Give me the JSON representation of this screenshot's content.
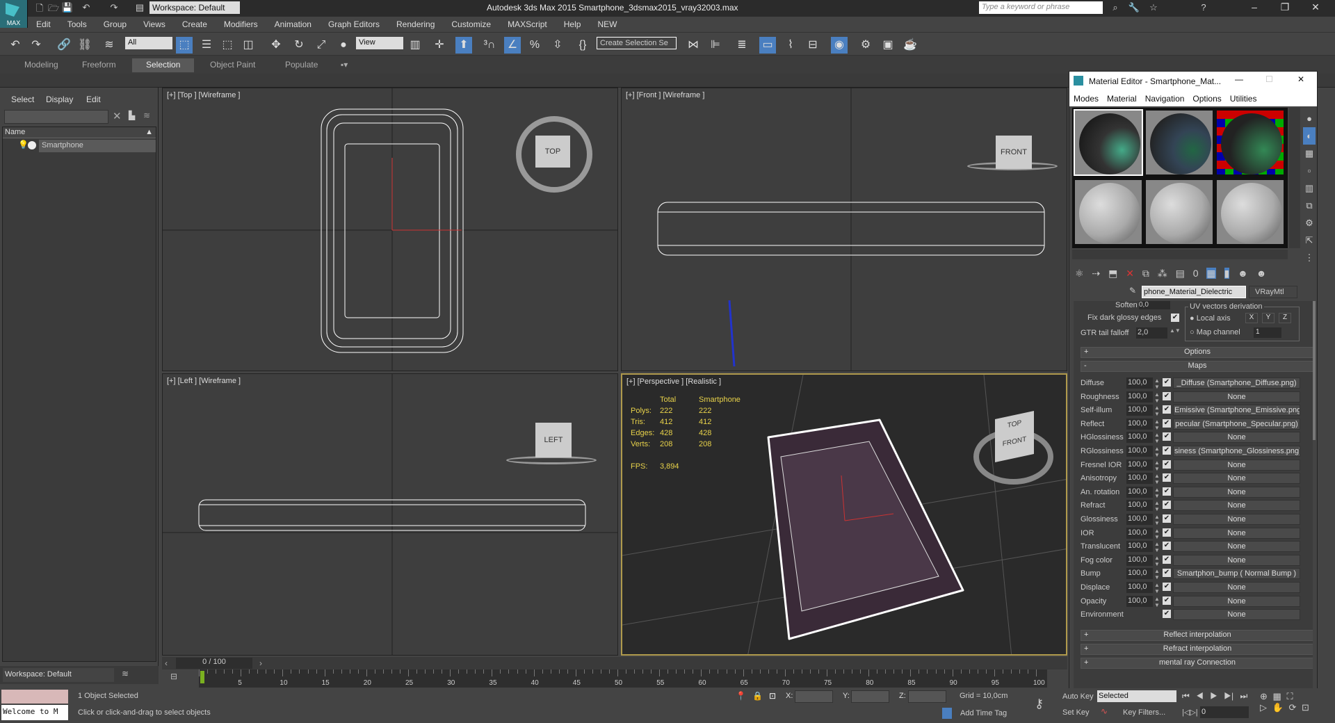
{
  "titlebar": {
    "workspace": "Workspace: Default",
    "app_title": "Autodesk 3ds Max  2015    Smartphone_3dsmax2015_vray32003.max",
    "search_placeholder": "Type a keyword or phrase",
    "logo_text": "MAX"
  },
  "menu": [
    "Edit",
    "Tools",
    "Group",
    "Views",
    "Create",
    "Modifiers",
    "Animation",
    "Graph Editors",
    "Rendering",
    "Customize",
    "MAXScript",
    "Help",
    "NEW"
  ],
  "toolbar": {
    "filter": "All",
    "ref_coord": "View",
    "selection_set": "Create Selection Se"
  },
  "ribbon": {
    "tabs": [
      "Modeling",
      "Freeform",
      "Selection",
      "Object Paint",
      "Populate"
    ],
    "active": "Selection"
  },
  "scene_explorer": {
    "tabs": [
      "Select",
      "Display",
      "Edit"
    ],
    "column": "Name",
    "items": [
      "Smartphone"
    ],
    "workspace": "Workspace: Default"
  },
  "viewports": {
    "top": {
      "label": "[+] [Top ] [Wireframe ]",
      "cube": "TOP"
    },
    "front": {
      "label": "[+] [Front ] [Wireframe ]",
      "cube": "FRONT"
    },
    "left": {
      "label": "[+] [Left ] [Wireframe ]",
      "cube": "LEFT"
    },
    "perspective": {
      "label": "[+] [Perspective ] [Realistic ]",
      "cube_top": "TOP",
      "cube_front": "FRONT",
      "stats": {
        "headers": [
          "Total",
          "Smartphone"
        ],
        "rows": [
          {
            "k": "Polys:",
            "total": "222",
            "obj": "222"
          },
          {
            "k": "Tris:",
            "total": "412",
            "obj": "412"
          },
          {
            "k": "Edges:",
            "total": "428",
            "obj": "428"
          },
          {
            "k": "Verts:",
            "total": "208",
            "obj": "208"
          }
        ],
        "fps_label": "FPS:",
        "fps": "3,894"
      }
    }
  },
  "material_editor": {
    "title": "Material Editor - Smartphone_Mat...",
    "menu": [
      "Modes",
      "Material",
      "Navigation",
      "Options",
      "Utilities"
    ],
    "material_name": "phone_Material_Dielectric",
    "material_type": "VRayMtl",
    "soften_label": "Soften",
    "soften": "0,0",
    "fix_dark_label": "Fix dark glossy edges",
    "gtr_label": "GTR tail falloff",
    "gtr": "2,0",
    "uv_group": "UV vectors derivation",
    "local_axis": "Local axis",
    "axes": [
      "X",
      "Y",
      "Z"
    ],
    "map_channel_label": "Map channel",
    "map_channel": "1",
    "rollouts_top": [
      {
        "sign": "+",
        "label": "Options"
      },
      {
        "sign": "-",
        "label": "Maps"
      }
    ],
    "maps": [
      {
        "label": "Diffuse",
        "value": "100,0",
        "map": "_Diffuse (Smartphone_Diffuse.png)"
      },
      {
        "label": "Roughness",
        "value": "100,0",
        "map": "None"
      },
      {
        "label": "Self-illum",
        "value": "100,0",
        "map": "Emissive (Smartphone_Emissive.png)"
      },
      {
        "label": "Reflect",
        "value": "100,0",
        "map": "pecular (Smartphone_Specular.png)"
      },
      {
        "label": "HGlossiness",
        "value": "100,0",
        "map": "None"
      },
      {
        "label": "RGlossiness",
        "value": "100,0",
        "map": "siness (Smartphone_Glossiness.png)"
      },
      {
        "label": "Fresnel IOR",
        "value": "100,0",
        "map": "None"
      },
      {
        "label": "Anisotropy",
        "value": "100,0",
        "map": "None"
      },
      {
        "label": "An. rotation",
        "value": "100,0",
        "map": "None"
      },
      {
        "label": "Refract",
        "value": "100,0",
        "map": "None"
      },
      {
        "label": "Glossiness",
        "value": "100,0",
        "map": "None"
      },
      {
        "label": "IOR",
        "value": "100,0",
        "map": "None"
      },
      {
        "label": "Translucent",
        "value": "100,0",
        "map": "None"
      },
      {
        "label": "Fog color",
        "value": "100,0",
        "map": "None"
      },
      {
        "label": "Bump",
        "value": "100,0",
        "map": "Smartphon_bump  ( Normal Bump )"
      },
      {
        "label": "Displace",
        "value": "100,0",
        "map": "None"
      },
      {
        "label": "Opacity",
        "value": "100,0",
        "map": "None"
      },
      {
        "label": "Environment",
        "value": "",
        "map": "None"
      }
    ],
    "rollouts_bottom": [
      {
        "sign": "+",
        "label": "Reflect interpolation"
      },
      {
        "sign": "+",
        "label": "Refract interpolation"
      },
      {
        "sign": "+",
        "label": "mental ray Connection"
      }
    ]
  },
  "timeline": {
    "frame": "0 / 100",
    "ticks": [
      "5",
      "10",
      "15",
      "20",
      "25",
      "30",
      "35",
      "40",
      "45",
      "50",
      "55",
      "60",
      "65",
      "70",
      "75",
      "80",
      "85",
      "90",
      "95",
      "100"
    ]
  },
  "status": {
    "selection": "1 Object Selected",
    "prompt": "Click or click-and-drag to select objects",
    "script": "Welcome to M",
    "x_label": "X:",
    "y_label": "Y:",
    "z_label": "Z:",
    "grid": "Grid = 10,0cm",
    "add_time_tag": "Add Time Tag",
    "auto_key": "Auto Key",
    "set_key": "Set Key",
    "key_mode": "Selected",
    "key_filters": "Key Filters...",
    "current_frame": "0"
  }
}
